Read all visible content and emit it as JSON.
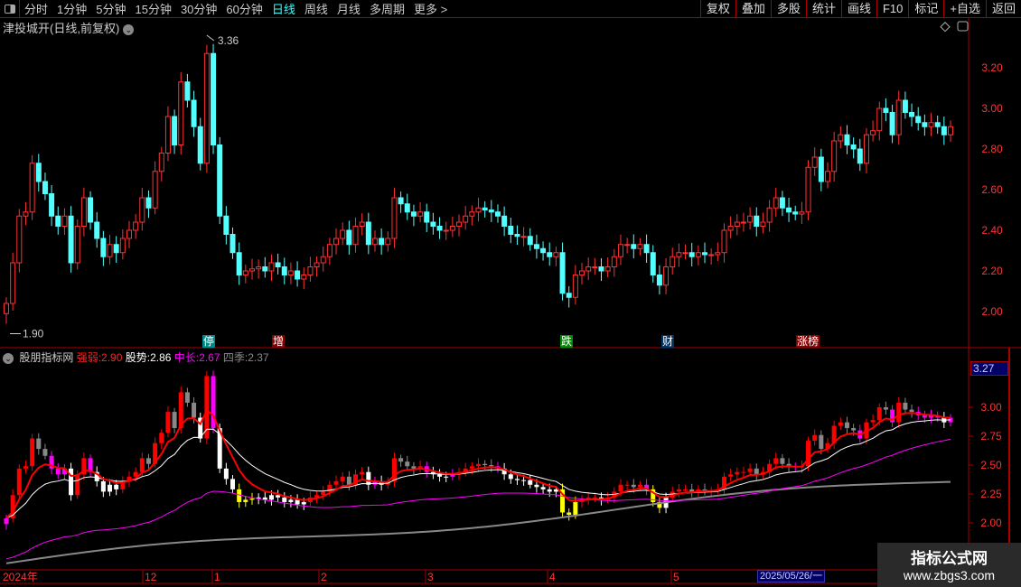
{
  "toolbar": {
    "periods": [
      "分时",
      "1分钟",
      "5分钟",
      "15分钟",
      "30分钟",
      "60分钟",
      "日线",
      "周线",
      "月线",
      "多周期",
      "更多 >"
    ],
    "active": "日线",
    "buttons": [
      "复权",
      "叠加",
      "多股",
      "统计",
      "画线",
      "F10",
      "标记",
      "+自选",
      "返回"
    ]
  },
  "stock_title": "津投城开(日线,前复权)",
  "main_axis": [
    "3.20",
    "3.00",
    "2.80",
    "2.60",
    "2.40",
    "2.20",
    "2.00"
  ],
  "high_label": "3.36",
  "low_label": "1.90",
  "markers": [
    {
      "text": "停",
      "color": "#088"
    },
    {
      "text": "增",
      "color": "#800"
    },
    {
      "text": "跌",
      "color": "#080"
    },
    {
      "text": "财",
      "color": "#036"
    },
    {
      "text": "涨榜",
      "color": "#800"
    }
  ],
  "indicator": {
    "name": "股朋指标网",
    "strong_label": "强弱:",
    "strong": "2.90",
    "trend_label": "股势:",
    "trend": "2.86",
    "mid_label": "中长:",
    "mid": "2.67",
    "season_label": "四季:",
    "season": "2.37",
    "last": "3.27"
  },
  "sub_axis": [
    "3.00",
    "2.75",
    "2.50",
    "2.25",
    "2.00"
  ],
  "dates": [
    "2024年",
    "12",
    "1",
    "2",
    "3",
    "4",
    "5"
  ],
  "cursor_date": "2025/05/26/一",
  "watermark": {
    "title": "指标公式网",
    "url": "www.zbgs3.com"
  },
  "colors": {
    "up": "#ff3232",
    "down": "#54ffff",
    "strong": "#ff0000",
    "trend": "#ffffff",
    "mid": "#ff00ff",
    "season": "#888888"
  },
  "chart_data": {
    "type": "candlestick",
    "closes": [
      2.04,
      2.24,
      2.47,
      2.49,
      2.73,
      2.64,
      2.58,
      2.47,
      2.42,
      2.47,
      2.24,
      2.42,
      2.56,
      2.44,
      2.36,
      2.27,
      2.33,
      2.29,
      2.36,
      2.4,
      2.44,
      2.56,
      2.51,
      2.69,
      2.78,
      2.96,
      2.82,
      3.13,
      3.04,
      2.91,
      2.73,
      3.27,
      2.82,
      2.47,
      2.38,
      2.29,
      2.18,
      2.2,
      2.21,
      2.22,
      2.2,
      2.24,
      2.22,
      2.18,
      2.2,
      2.16,
      2.18,
      2.22,
      2.24,
      2.27,
      2.33,
      2.36,
      2.4,
      2.33,
      2.42,
      2.44,
      2.33,
      2.36,
      2.33,
      2.36,
      2.56,
      2.53,
      2.49,
      2.47,
      2.49,
      2.44,
      2.42,
      2.4,
      2.4,
      2.42,
      2.44,
      2.47,
      2.49,
      2.51,
      2.5,
      2.49,
      2.47,
      2.42,
      2.38,
      2.37,
      2.37,
      2.33,
      2.31,
      2.29,
      2.27,
      2.29,
      2.09,
      2.07,
      2.18,
      2.2,
      2.22,
      2.22,
      2.2,
      2.22,
      2.27,
      2.33,
      2.33,
      2.31,
      2.33,
      2.29,
      2.18,
      2.13,
      2.22,
      2.27,
      2.29,
      2.29,
      2.27,
      2.29,
      2.28,
      2.28,
      2.29,
      2.4,
      2.42,
      2.44,
      2.44,
      2.47,
      2.42,
      2.44,
      2.51,
      2.56,
      2.51,
      2.49,
      2.48,
      2.49,
      2.71,
      2.76,
      2.64,
      2.69,
      2.84,
      2.87,
      2.82,
      2.8,
      2.73,
      2.87,
      2.89,
      3.0,
      2.98,
      2.87,
      3.04,
      2.98,
      2.96,
      2.93,
      2.91,
      2.93,
      2.91,
      2.87,
      2.91
    ]
  }
}
